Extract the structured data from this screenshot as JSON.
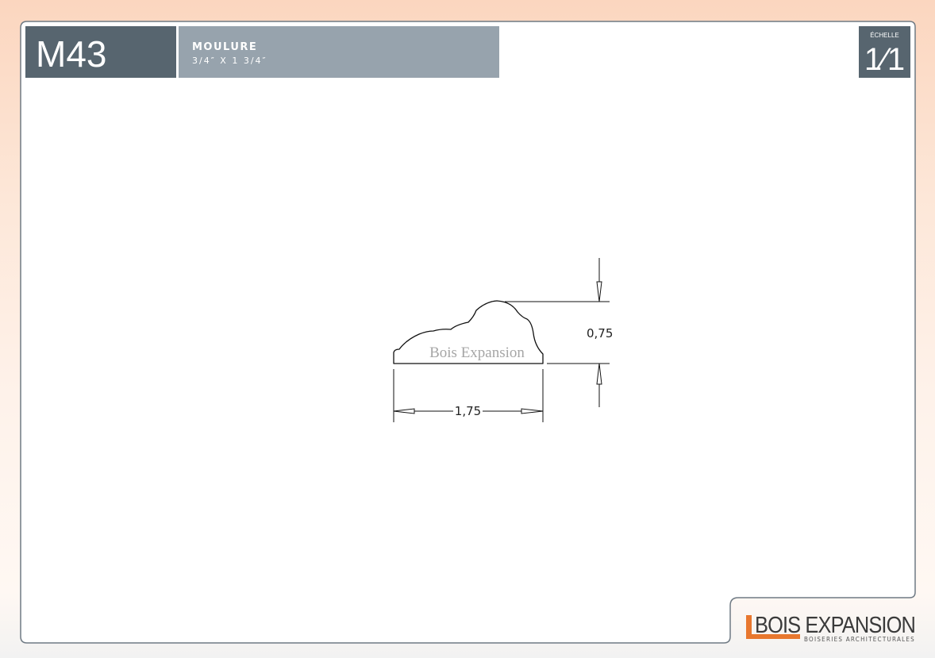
{
  "header": {
    "product_code": "M43",
    "product_type": "MOULURE",
    "dimensions": "3/4″ X 1 3/4″"
  },
  "scale": {
    "label": "ÉCHELLE",
    "value": "1⁄1"
  },
  "drawing": {
    "watermark": "Bois Expansion",
    "height_dimension": "0,75",
    "width_dimension": "1,75"
  },
  "brand": {
    "name": "BOIS EXPANSION",
    "tagline": "BOISERIES ARCHITECTURALES",
    "accent_color": "#e8772e"
  },
  "colors": {
    "code_box": "#57656f",
    "title_box": "#97a3ad",
    "scale_box": "#57656f",
    "frame": "#6f7a84"
  }
}
